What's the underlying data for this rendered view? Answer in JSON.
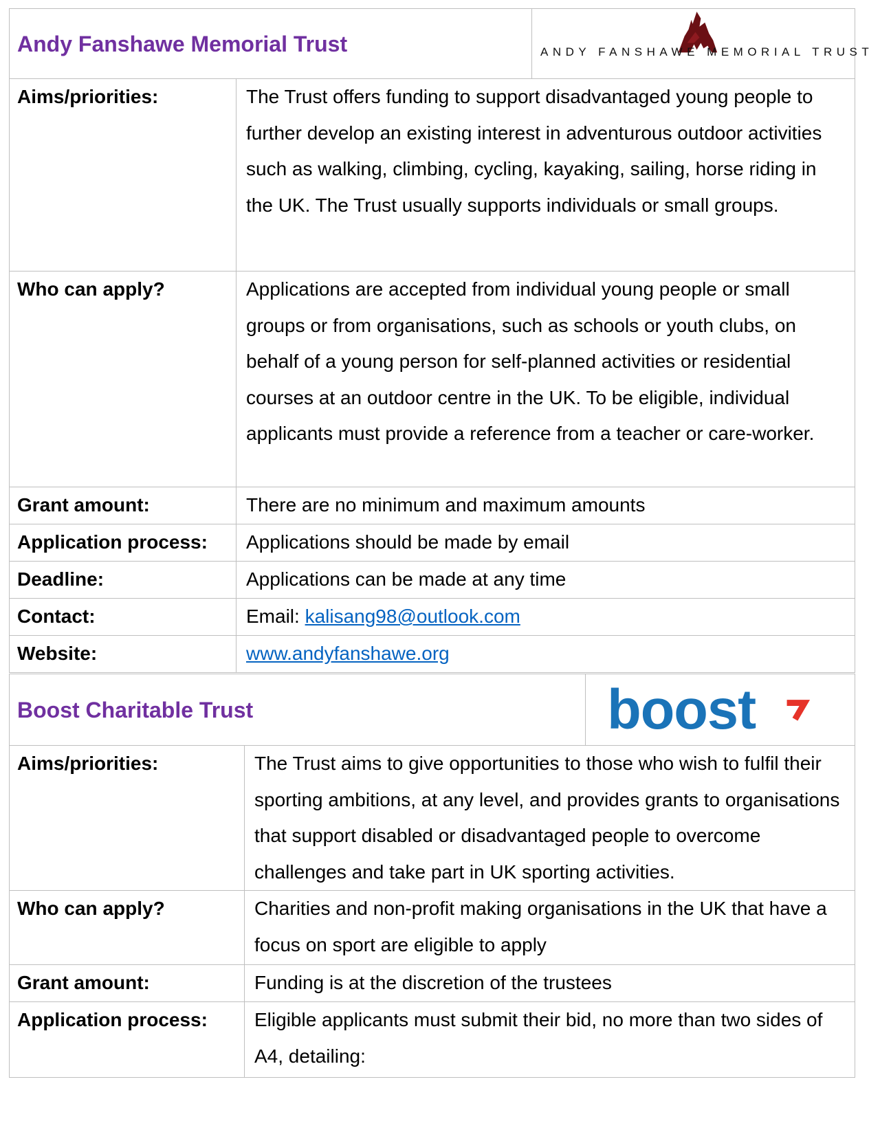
{
  "trusts": [
    {
      "title": "Andy Fanshawe Memorial Trust",
      "logo": {
        "icon": "afmt-mountain-logo",
        "text": "ANDY FANSHAWE MEMORIAL TRUST",
        "color": "#6b1014"
      },
      "rows": [
        {
          "label": "Aims/priorities:",
          "value": "The Trust offers funding to support disadvantaged young people to further develop an existing interest in adventurous outdoor activities such as walking, climbing, cycling, kayaking, sailing, horse riding in the UK. The Trust usually supports individuals or small groups."
        },
        {
          "label": "Who can apply?",
          "value": "Applications are accepted from individual young people or small groups or from organisations, such as schools or youth clubs, on behalf of a young person for self-planned activities or residential courses at an outdoor centre in the UK. To be eligible, individual applicants must provide a reference from a teacher or care-worker."
        },
        {
          "label": "Grant amount:",
          "value": "There are no minimum and maximum amounts"
        },
        {
          "label": "Application process:",
          "value": "Applications should be made by email"
        },
        {
          "label": "Deadline:",
          "value": "Applications can be made at any time"
        },
        {
          "label": "Contact:",
          "value_prefix": "Email: ",
          "link": "kalisang98@outlook.com"
        },
        {
          "label": "Website:",
          "link": "www.andyfanshawe.org"
        }
      ]
    },
    {
      "title": "Boost Charitable Trust",
      "logo": {
        "icon": "boost-logo",
        "text": "boost",
        "color": "#1a73b8",
        "accent": "#e63329"
      },
      "rows": [
        {
          "label": "Aims/priorities:",
          "value": "The Trust aims to give opportunities to those who wish to fulfil their sporting ambitions, at any level, and provides grants to organisations that support disabled or disadvantaged people to overcome challenges and take part in UK sporting activities."
        },
        {
          "label": "Who can apply?",
          "value": "Charities and non-profit making organisations in the UK that have a focus on sport are eligible to apply"
        },
        {
          "label": "Grant amount:",
          "value": "Funding is at the discretion of the trustees"
        },
        {
          "label": "Application process:",
          "value": "Eligible applicants must submit their bid, no more than two sides of A4, detailing:"
        }
      ]
    }
  ]
}
